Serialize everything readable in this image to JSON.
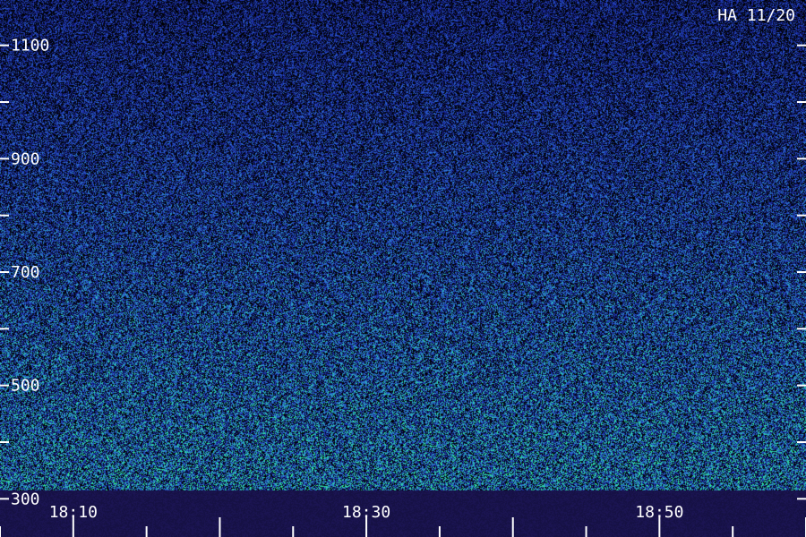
{
  "chart_data": {
    "type": "heatmap",
    "title": "HA 11/20",
    "y_ticks": [
      300,
      500,
      700,
      900,
      1100
    ],
    "y_tick_labels": [
      "300",
      "500",
      "700",
      "900",
      "1100"
    ],
    "ylim": [
      280,
      1180
    ],
    "x_ticks": [
      "18:10",
      "18:30",
      "18:50"
    ],
    "x_range": [
      "18:05",
      "19:00"
    ],
    "colors": {
      "background": "#000000",
      "band": "#1a1450",
      "low": "#1b2aa8",
      "mid": "#2f6fd6",
      "high": "#2bd3b0",
      "peak": "#33ff88",
      "tick": "#ffffff"
    }
  }
}
